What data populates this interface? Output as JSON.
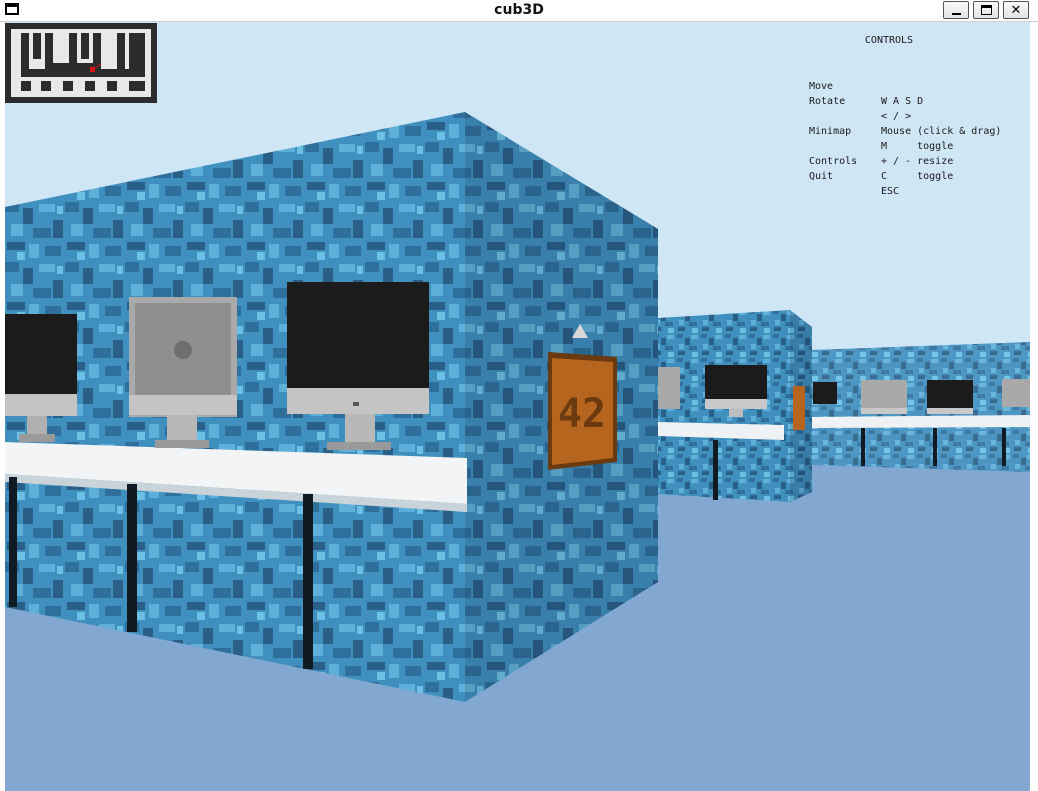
{
  "window": {
    "title": "cub3D",
    "buttons": {
      "minimize": "minimize",
      "maximize": "maximize",
      "close": "✕"
    }
  },
  "controls": {
    "heading": "CONTROLS",
    "rows": [
      {
        "key": "Move",
        "value": "W A S D"
      },
      {
        "key": "Rotate",
        "value": "< / >"
      },
      {
        "key": "",
        "value": "Mouse (click & drag)"
      },
      {
        "key": "Minimap",
        "value": "M     toggle"
      },
      {
        "key": "",
        "value": "+ / - resize"
      },
      {
        "key": "Controls",
        "value": "C     toggle"
      },
      {
        "key": "Quit",
        "value": "ESC"
      }
    ]
  },
  "scene": {
    "sign_text": "42",
    "colors": {
      "sky": "#cfe6f5",
      "floor": "#82a8d2",
      "wall_dark": "#2f6f9b",
      "wall_mid": "#3f8fbf",
      "wall_light": "#5fb0d8",
      "desk": "#f2f4f6",
      "monitor_screen": "#1b1b1b",
      "monitor_silver": "#b5b5b5",
      "sign": "#b5651d"
    }
  },
  "minimap": {
    "wall_color": "#e8e8e8",
    "floor_color": "#2c2c2c",
    "player_color": "#e01010"
  }
}
